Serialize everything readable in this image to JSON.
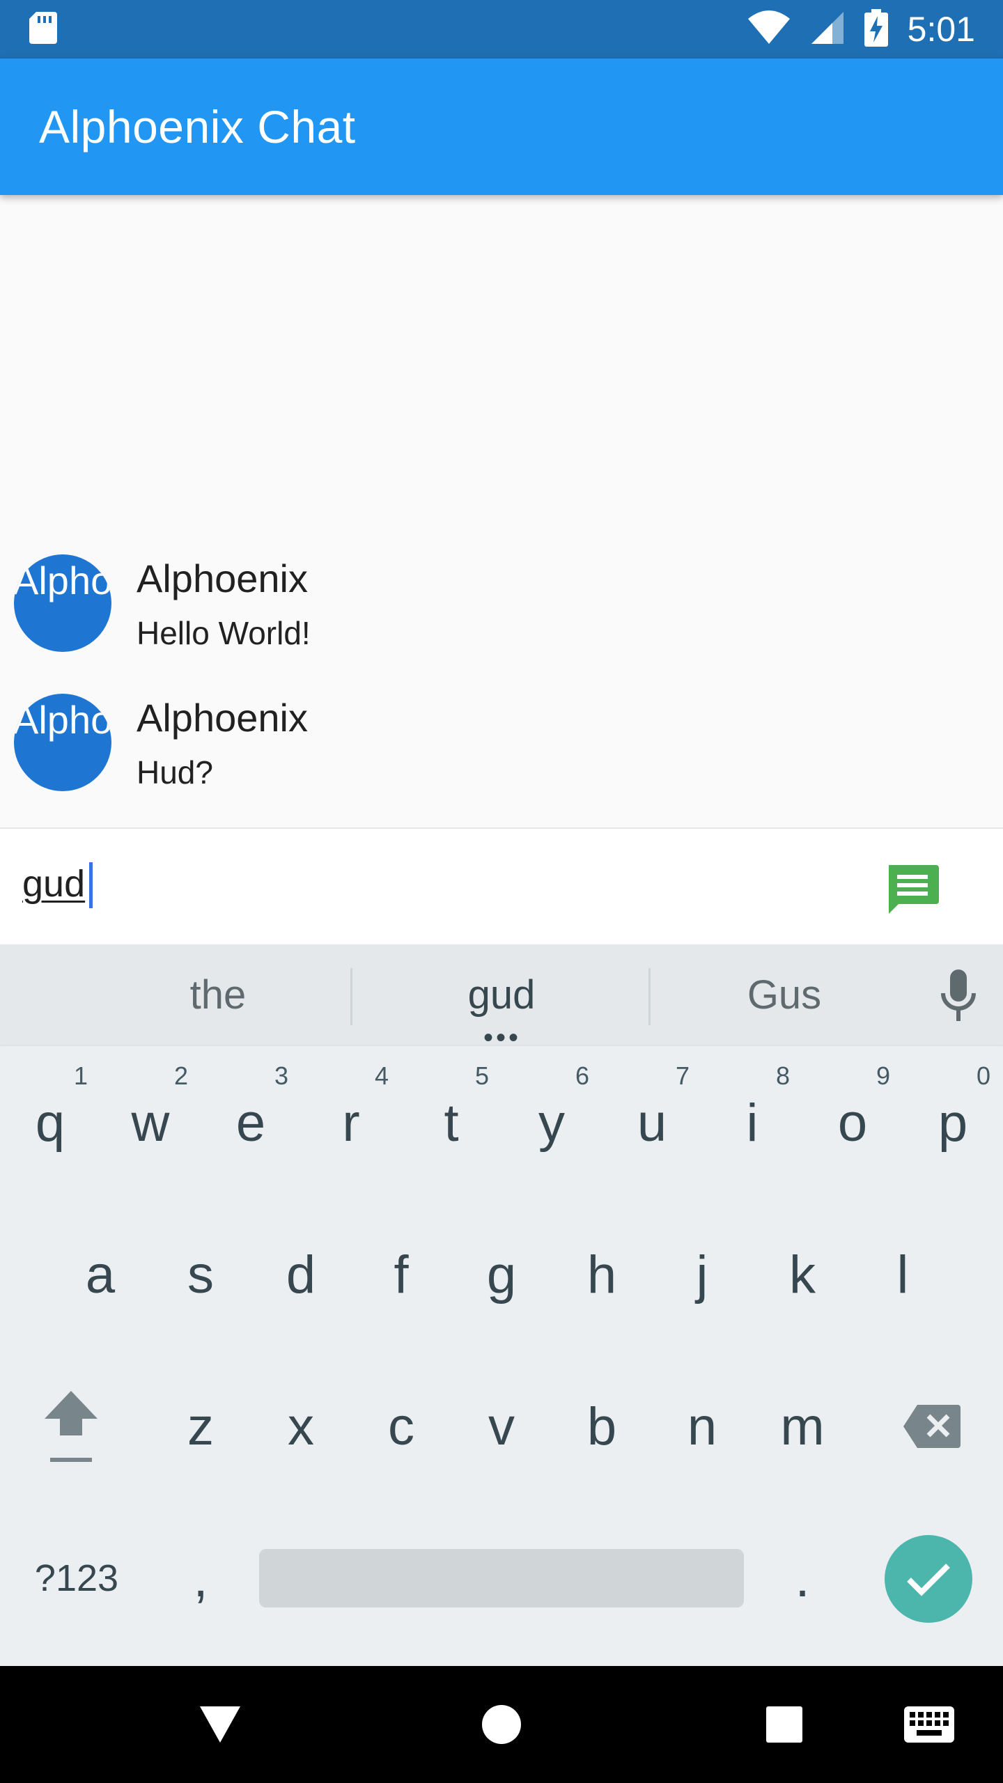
{
  "status_bar": {
    "time": "5:01",
    "icons": [
      "sd-card-icon",
      "wifi-icon",
      "cell-signal-icon",
      "battery-charging-icon"
    ]
  },
  "app_bar": {
    "title": "Alphoenix Chat"
  },
  "messages": [
    {
      "avatar_text": "Alphoenix",
      "name": "Alphoenix",
      "text": "Hello World!"
    },
    {
      "avatar_text": "Alphoenix",
      "name": "Alphoenix",
      "text": "Hud?"
    }
  ],
  "composer": {
    "value": "gud",
    "send_icon": "send-message-icon"
  },
  "keyboard": {
    "suggestions": [
      "the",
      "gud",
      "Gus"
    ],
    "row1": [
      "q",
      "w",
      "e",
      "r",
      "t",
      "y",
      "u",
      "i",
      "o",
      "p"
    ],
    "row1_hints": [
      "1",
      "2",
      "3",
      "4",
      "5",
      "6",
      "7",
      "8",
      "9",
      "0"
    ],
    "row2": [
      "a",
      "s",
      "d",
      "f",
      "g",
      "h",
      "j",
      "k",
      "l"
    ],
    "row3": [
      "z",
      "x",
      "c",
      "v",
      "b",
      "n",
      "m"
    ],
    "symbols_label": "?123",
    "comma_label": ",",
    "period_label": "."
  },
  "colors": {
    "status_bar": "#1e6fb3",
    "app_bar": "#2196f3",
    "avatar": "#1e76d2",
    "send_icon": "#4caf50",
    "enter_key": "#4db6ac",
    "caret": "#3d6fe8"
  }
}
